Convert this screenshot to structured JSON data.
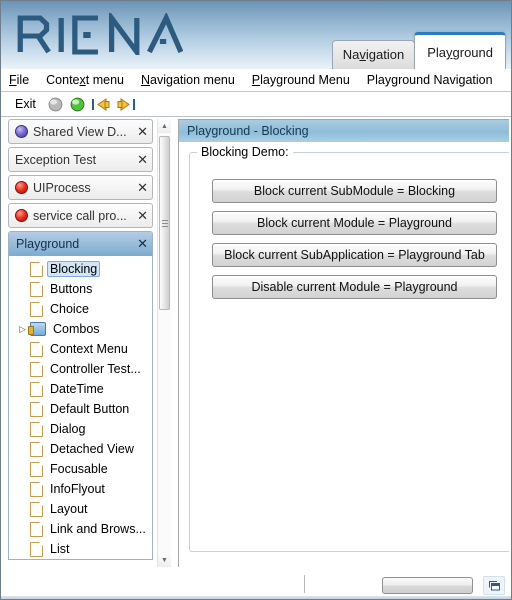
{
  "app": {
    "logo_text": "RIENA",
    "accent_color": "#2a7bc0",
    "title_gradient_top": "#6c93b5",
    "title_gradient_bottom": "#eaf2f8"
  },
  "subapp_tabs": [
    {
      "label": "Navigation",
      "mnemonic": "v",
      "active": false
    },
    {
      "label": "Playground",
      "mnemonic": "y",
      "active": true
    }
  ],
  "menubar": {
    "items": [
      {
        "label": "File",
        "mnemonic": "F"
      },
      {
        "label": "Context menu",
        "mnemonic": "x"
      },
      {
        "label": "Navigation menu",
        "mnemonic": "N"
      },
      {
        "label": "Playground Menu",
        "mnemonic": "P"
      },
      {
        "label": "Playground Navigation",
        "mnemonic": ""
      }
    ]
  },
  "toolbar": {
    "exit_label": "Exit",
    "icons": [
      {
        "name": "grey-sphere-icon"
      },
      {
        "name": "green-sphere-icon"
      },
      {
        "name": "back-to-first-arrow-icon"
      },
      {
        "name": "forward-to-last-arrow-icon"
      }
    ]
  },
  "navigation": {
    "modules": [
      {
        "label": "Shared View D...",
        "icon": "globe-icon",
        "close": "✕"
      },
      {
        "label": "Exception Test",
        "icon": "none",
        "close": "✕"
      },
      {
        "label": "UIProcess",
        "icon": "red-sphere-icon",
        "close": "✕"
      },
      {
        "label": "service call pro...",
        "icon": "red-sphere-icon",
        "close": "✕"
      }
    ],
    "active_group": {
      "title": "Playground",
      "close": "✕",
      "items": [
        {
          "label": "Blocking",
          "icon": "document-icon",
          "selected": true,
          "expandable": false
        },
        {
          "label": "Buttons",
          "icon": "document-icon",
          "selected": false,
          "expandable": false
        },
        {
          "label": "Choice",
          "icon": "document-icon",
          "selected": false,
          "expandable": false
        },
        {
          "label": "Combos",
          "icon": "folder-icon",
          "selected": false,
          "expandable": true
        },
        {
          "label": "Context Menu",
          "icon": "document-icon",
          "selected": false,
          "expandable": false
        },
        {
          "label": "Controller Test...",
          "icon": "document-icon",
          "selected": false,
          "expandable": false
        },
        {
          "label": "DateTime",
          "icon": "document-icon",
          "selected": false,
          "expandable": false
        },
        {
          "label": "Default Button",
          "icon": "document-icon",
          "selected": false,
          "expandable": false
        },
        {
          "label": "Dialog",
          "icon": "document-icon",
          "selected": false,
          "expandable": false
        },
        {
          "label": "Detached View",
          "icon": "document-icon",
          "selected": false,
          "expandable": false
        },
        {
          "label": "Focusable",
          "icon": "document-icon",
          "selected": false,
          "expandable": false
        },
        {
          "label": "InfoFlyout",
          "icon": "document-icon",
          "selected": false,
          "expandable": false
        },
        {
          "label": "Layout",
          "icon": "document-icon",
          "selected": false,
          "expandable": false
        },
        {
          "label": "Link and Brows...",
          "icon": "document-icon",
          "selected": false,
          "expandable": false
        },
        {
          "label": "List",
          "icon": "document-icon",
          "selected": false,
          "expandable": false
        }
      ]
    },
    "scrollbar": {
      "up_arrow": "▲",
      "down_arrow": "▼"
    }
  },
  "content": {
    "title": "Playground - Blocking",
    "group_legend": "Blocking Demo:",
    "buttons": [
      {
        "label": "Block current SubModule = Blocking"
      },
      {
        "label": "Block current Module = Playground"
      },
      {
        "label": "Block current SubApplication = Playground Tab"
      },
      {
        "label": "Disable current Module = Playground"
      }
    ]
  },
  "statusbar": {
    "message": "",
    "progress_value": "",
    "window_icon": "restore-window-icon"
  }
}
